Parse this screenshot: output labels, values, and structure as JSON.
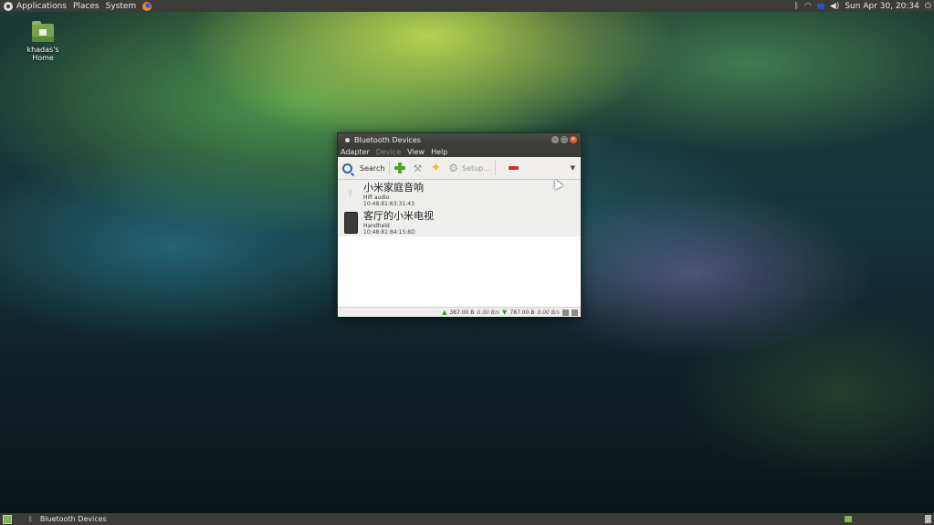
{
  "top_panel": {
    "menus": [
      "Applications",
      "Places",
      "System"
    ],
    "clock": "Sun Apr 30, 20:34"
  },
  "desktop": {
    "home_label": "khadas's Home"
  },
  "window": {
    "title": "Bluetooth Devices",
    "menubar": [
      "Adapter",
      "Device",
      "View",
      "Help"
    ],
    "toolbar": {
      "search_label": "Search",
      "setup_label": "Setup..."
    },
    "devices": [
      {
        "name": "小米家庭音响",
        "type": "Hifi audio",
        "mac": "10:48:81:63:31:43"
      },
      {
        "name": "客厅的小米电视",
        "type": "Handheld",
        "mac": "10:48:81:84:15:8D"
      }
    ],
    "status": {
      "upload_total": "387.00 B",
      "upload_rate": "0.00 B/s",
      "download_total": "787.00 B",
      "download_rate": "0.00 B/s"
    }
  },
  "taskbar": {
    "task_label": "Bluetooth Devices"
  }
}
